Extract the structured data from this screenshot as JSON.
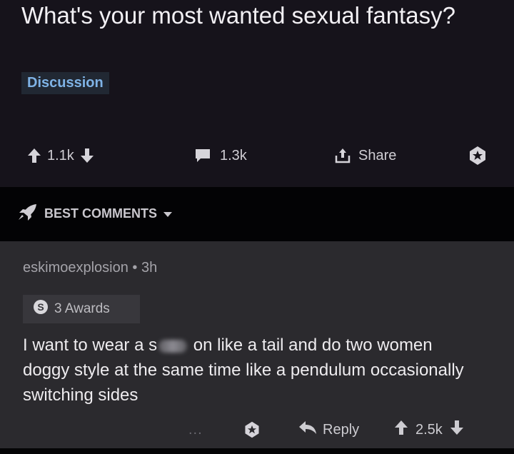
{
  "post": {
    "title": "What's your most wanted sexual fantasy?",
    "flair": "Discussion",
    "score": "1.1k",
    "comment_count": "1.3k",
    "share_label": "Share"
  },
  "sort": {
    "label": "BEST COMMENTS"
  },
  "comment": {
    "author": "eskimoexplosion",
    "separator": "•",
    "age": "3h",
    "awards_label": "3 Awards",
    "text_before": "I want to wear a s",
    "text_after": " on like a tail and do two women doggy style at the same time like a pendulum occasionally switching sides",
    "more": "...",
    "reply_label": "Reply",
    "score": "2.5k"
  },
  "colors": {
    "background": "#16131b",
    "sort_bar": "#030305",
    "comment_bg": "#2b2a2e",
    "flair_text": "#7fb3e6"
  }
}
